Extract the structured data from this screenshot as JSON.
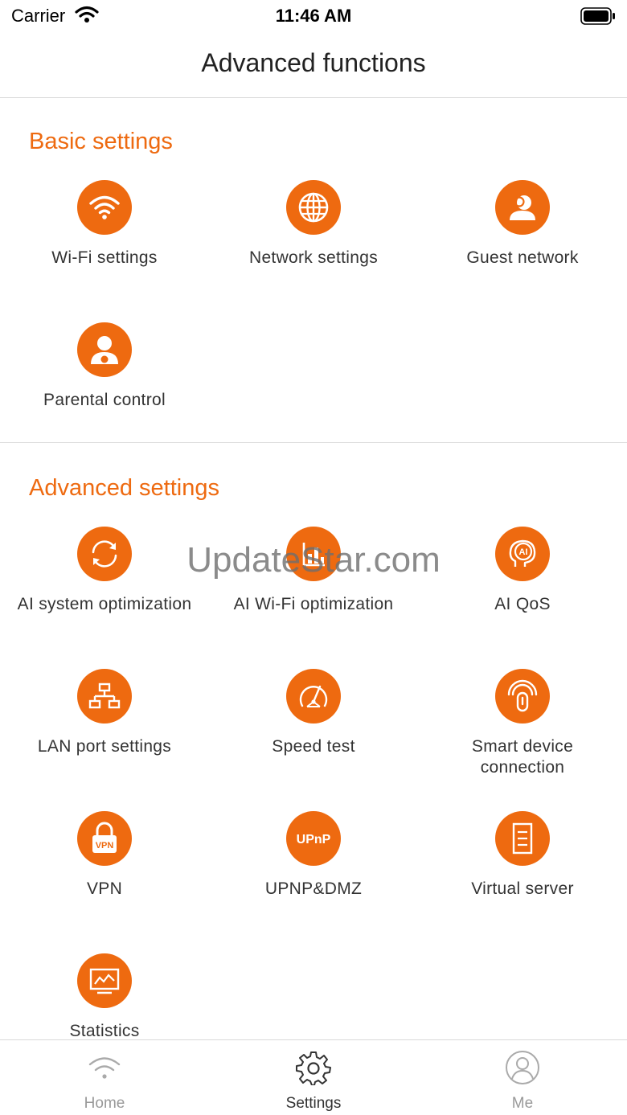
{
  "status_bar": {
    "carrier": "Carrier",
    "time": "11:46 AM"
  },
  "nav": {
    "title": "Advanced functions"
  },
  "basic_settings": {
    "title": "Basic settings",
    "items": [
      {
        "label": "Wi-Fi settings",
        "icon": "wifi-icon"
      },
      {
        "label": "Network settings",
        "icon": "globe-icon"
      },
      {
        "label": "Guest network",
        "icon": "guest-icon"
      },
      {
        "label": "Parental control",
        "icon": "parent-icon"
      }
    ]
  },
  "advanced_settings": {
    "title": "Advanced settings",
    "items": [
      {
        "label": "AI system optimization",
        "icon": "refresh-icon"
      },
      {
        "label": "AI Wi-Fi optimization",
        "icon": "chart-icon"
      },
      {
        "label": "AI QoS",
        "icon": "ai-head-icon",
        "icon_text": "AI"
      },
      {
        "label": "LAN port settings",
        "icon": "network-tree-icon"
      },
      {
        "label": "Speed test",
        "icon": "speedometer-icon"
      },
      {
        "label": "Smart device connection",
        "icon": "smart-device-icon"
      },
      {
        "label": "VPN",
        "icon": "lock-icon",
        "icon_text": "VPN"
      },
      {
        "label": "UPNP&DMZ",
        "icon": "upnp-icon",
        "icon_text": "UPnP"
      },
      {
        "label": "Virtual server",
        "icon": "server-icon"
      },
      {
        "label": "Statistics",
        "icon": "monitor-icon"
      }
    ]
  },
  "watermark": "UpdateStar.com",
  "tab_bar": {
    "tabs": [
      {
        "label": "Home",
        "icon": "home-wifi-icon",
        "active": false
      },
      {
        "label": "Settings",
        "icon": "gear-icon",
        "active": true
      },
      {
        "label": "Me",
        "icon": "user-icon",
        "active": false
      }
    ]
  },
  "colors": {
    "accent": "#ee6a10",
    "text": "#333333",
    "inactive": "#999999"
  }
}
